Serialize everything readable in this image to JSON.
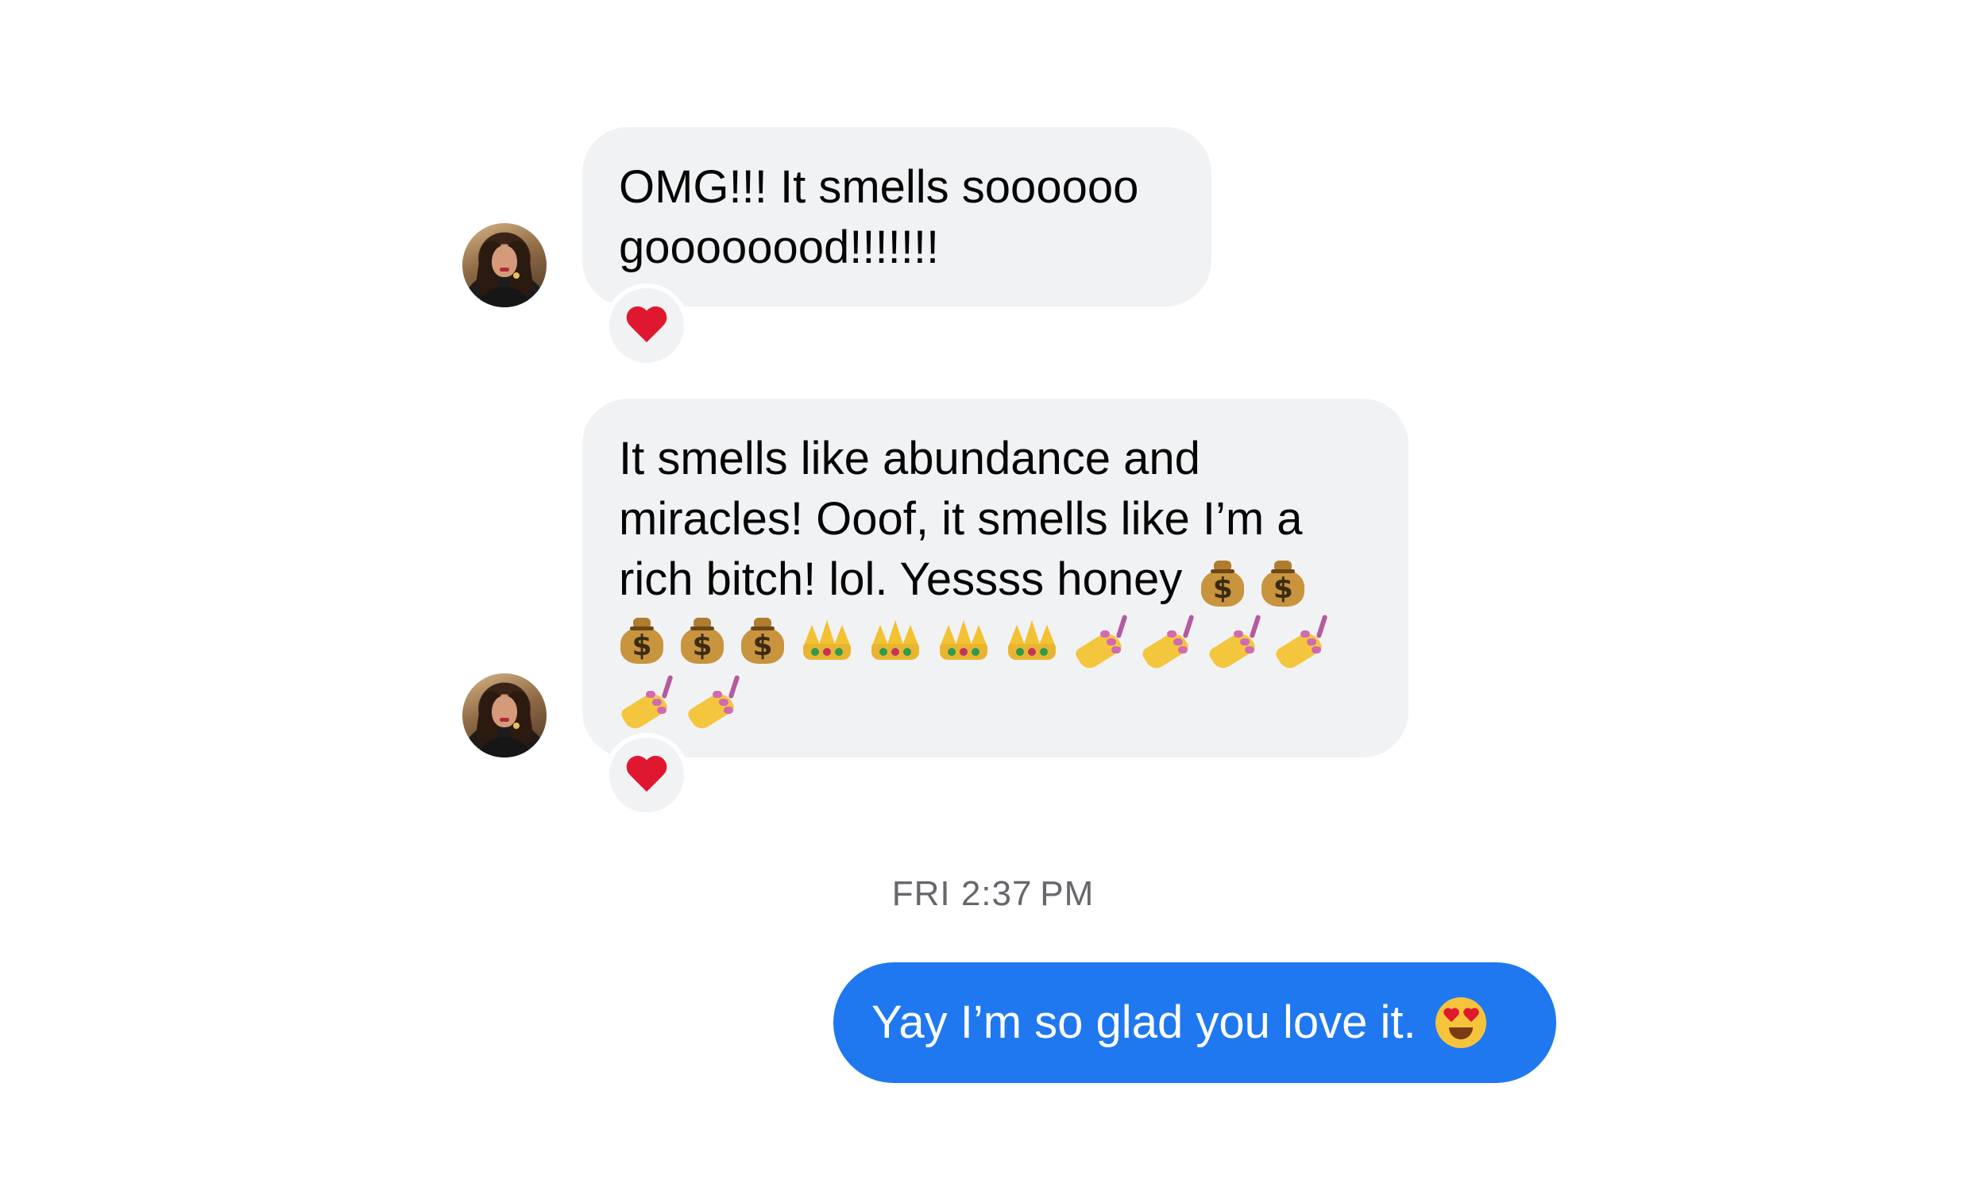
{
  "messages": [
    {
      "direction": "incoming",
      "lines": [
        "OMG!!! It smells soooooo",
        "goooooood!!!!!!!"
      ],
      "reaction": "heart"
    },
    {
      "direction": "incoming",
      "lines": [
        "It smells like abundance and",
        "miracles! Ooof, it smells like I’m a",
        "rich bitch! lol. Yessss honey"
      ],
      "emojis": [
        "money-bag",
        "money-bag",
        "money-bag",
        "money-bag",
        "money-bag",
        "crown",
        "crown",
        "crown",
        "crown",
        "nail-polish",
        "nail-polish",
        "nail-polish",
        "nail-polish",
        "nail-polish",
        "nail-polish"
      ],
      "reaction": "heart"
    },
    {
      "direction": "outgoing",
      "text": "Yay I’m so glad you love it.",
      "emoji": "smiling-face-with-heart-eyes"
    }
  ],
  "timestamp": "FRI 2:37 PM",
  "emoji_glyphs": {
    "money_bag_symbol": "$"
  },
  "colors": {
    "incoming_bubble": "#f1f2f4",
    "outgoing_bubble": "#1f78f0",
    "timestamp_text": "#65676b",
    "reaction_heart": "#e0182f"
  }
}
